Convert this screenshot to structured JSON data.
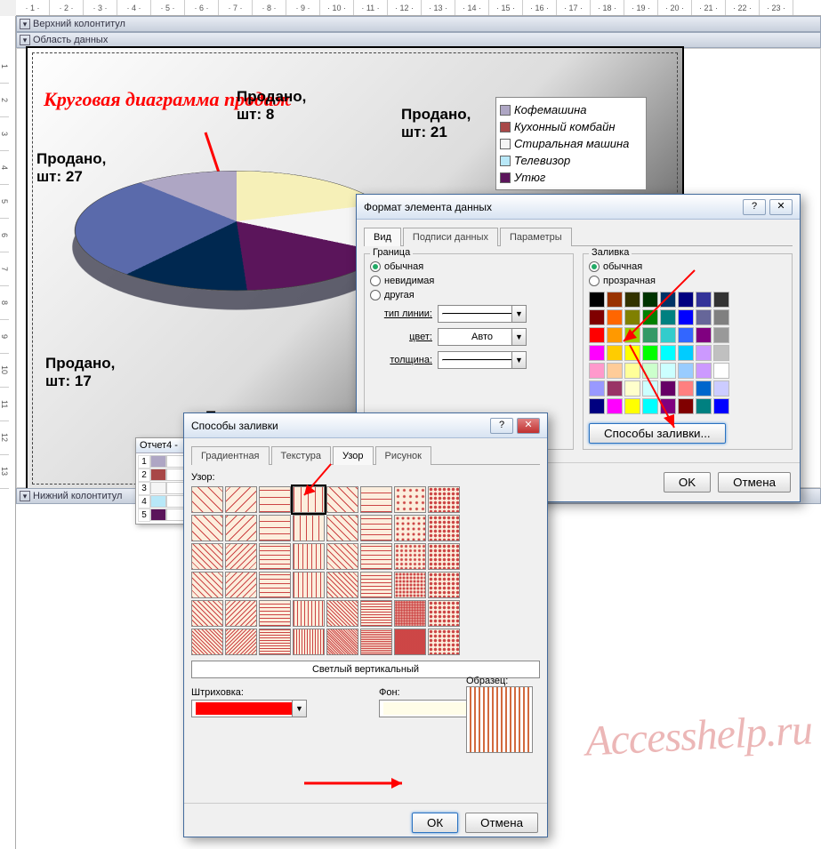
{
  "ruler": {
    "h": [
      "1",
      "2",
      "3",
      "4",
      "5",
      "6",
      "7",
      "8",
      "9",
      "10",
      "11",
      "12",
      "13",
      "14",
      "15",
      "16",
      "17",
      "18",
      "19",
      "20",
      "21",
      "22",
      "23"
    ],
    "v": [
      "",
      "1",
      "2",
      "3",
      "4",
      "5",
      "6",
      "7",
      "8",
      "9",
      "10",
      "11",
      "12",
      "13"
    ]
  },
  "sections": {
    "header": "Верхний колонтитул",
    "detail": "Область данных",
    "footer": "Нижний колонтитул"
  },
  "annotation": "Круговая диаграмма продаж",
  "chart_data": {
    "type": "pie",
    "title": "Продано",
    "series_unit": "шт",
    "categories": [
      "Кофемашина",
      "Кухонный комбайн",
      "Стиральная машина",
      "Телевизор",
      "Утюг"
    ],
    "labels": [
      {
        "text_l1": "Продано,",
        "text_l2": "шт: 8"
      },
      {
        "text_l1": "Продано,",
        "text_l2": "шт: 21"
      },
      {
        "text_l1": "Продано,",
        "text_l2": "шт: 27"
      },
      {
        "text_l1": "Продано,",
        "text_l2": "шт: 17"
      },
      {
        "text_l1": "Продано,",
        "text_l2": ""
      }
    ],
    "colors": [
      "#aea6c4",
      "#a84848",
      "#f5f5f5",
      "#b8e8f8",
      "#5b155b"
    ]
  },
  "legend": {
    "items": [
      {
        "color": "#aea6c4",
        "text": "Кофемашина"
      },
      {
        "color": "#a84848",
        "text": "Кухонный комбайн"
      },
      {
        "color": "#f5f5f5",
        "text": "Стиральная машина"
      },
      {
        "color": "#b8e8f8",
        "text": "Телевизор"
      },
      {
        "color": "#5b155b",
        "text": "Утюг"
      }
    ]
  },
  "mini_palette": {
    "title": "Отчет4 -",
    "rows": [
      {
        "n": "1",
        "c": "#aea6c4"
      },
      {
        "n": "2",
        "c": "#a84848"
      },
      {
        "n": "3",
        "c": "#f5f5f5"
      },
      {
        "n": "4",
        "c": "#b8e8f8"
      },
      {
        "n": "5",
        "c": "#5b155b"
      }
    ]
  },
  "format_dialog": {
    "title": "Формат элемента данных",
    "tabs": [
      "Вид",
      "Подписи данных",
      "Параметры"
    ],
    "active_tab": "Вид",
    "border": {
      "label": "Граница",
      "options": [
        "обычная",
        "невидимая",
        "другая"
      ],
      "selected": "обычная",
      "line_type": "тип линии:",
      "color": "цвет:",
      "color_value": "Авто",
      "weight": "толщина:"
    },
    "fill": {
      "label": "Заливка",
      "options": [
        "обычная",
        "прозрачная"
      ],
      "selected": "обычная",
      "fill_methods_btn": "Способы заливки..."
    },
    "colors_grid": [
      "#000000",
      "#993300",
      "#333300",
      "#003300",
      "#003366",
      "#000080",
      "#333399",
      "#333333",
      "#800000",
      "#ff6600",
      "#808000",
      "#008000",
      "#008080",
      "#0000ff",
      "#666699",
      "#808080",
      "#ff0000",
      "#ff9900",
      "#99cc00",
      "#339966",
      "#33cccc",
      "#3366ff",
      "#800080",
      "#999999",
      "#ff00ff",
      "#ffcc00",
      "#ffff00",
      "#00ff00",
      "#00ffff",
      "#00ccff",
      "#cc99ff",
      "#c0c0c0",
      "#ff99cc",
      "#ffcc99",
      "#ffff99",
      "#ccffcc",
      "#ccffff",
      "#99ccff",
      "#cc99ff",
      "#ffffff",
      "#9999ff",
      "#993366",
      "#ffffcc",
      "#ccffff",
      "#660066",
      "#ff8080",
      "#0066cc",
      "#ccccff",
      "#000080",
      "#ff00ff",
      "#ffff00",
      "#00ffff",
      "#800080",
      "#800000",
      "#008080",
      "#0000ff"
    ],
    "ok": "OK",
    "cancel": "Отмена",
    "help": "?",
    "close": "✕"
  },
  "fill_dialog": {
    "title": "Способы заливки",
    "tabs": [
      "Градиентная",
      "Текстура",
      "Узор",
      "Рисунок"
    ],
    "active_tab": "Узор",
    "pattern_label": "Узор:",
    "selected_pattern_name": "Светлый вертикальный",
    "hatch_label": "Штриховка:",
    "bg_label": "Фон:",
    "hatch_color": "#ff0000",
    "bg_color": "#fffde8",
    "sample_label": "Образец:",
    "ok": "ОК",
    "cancel": "Отмена",
    "help": "?",
    "close": "✕"
  },
  "watermark": "Accesshelp.ru"
}
